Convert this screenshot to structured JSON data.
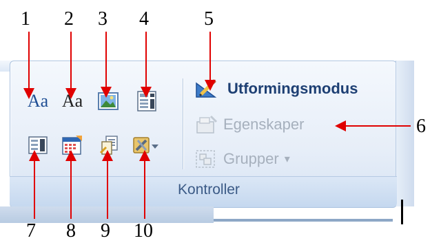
{
  "callouts": {
    "n1": "1",
    "n2": "2",
    "n3": "3",
    "n4": "4",
    "n5": "5",
    "n6": "6",
    "n7": "7",
    "n8": "8",
    "n9": "9",
    "n10": "10"
  },
  "ribbon": {
    "group_label": "Kontroller",
    "buttons": {
      "rich_text_glyph": "Aa",
      "plain_text_glyph": "Aa",
      "design_mode": "Utformingsmodus",
      "properties": "Egenskaper",
      "group": "Grupper",
      "group_dropdown_glyph": "▾"
    }
  },
  "icons": {
    "rich_text": "rich-text-control-icon",
    "plain_text": "plain-text-control-icon",
    "picture": "picture-control-icon",
    "combo_box": "combo-box-control-icon",
    "design_mode": "design-mode-icon",
    "properties": "properties-icon",
    "group": "group-icon",
    "dropdown_list": "dropdown-list-control-icon",
    "date_picker": "date-picker-control-icon",
    "building_block": "building-block-gallery-icon",
    "legacy_tools": "legacy-tools-icon"
  },
  "colors": {
    "callout_red": "#e00000",
    "accent_blue": "#1d3f73",
    "disabled_gray": "#a6b0bd",
    "ribbon_border": "#a9c1df"
  }
}
